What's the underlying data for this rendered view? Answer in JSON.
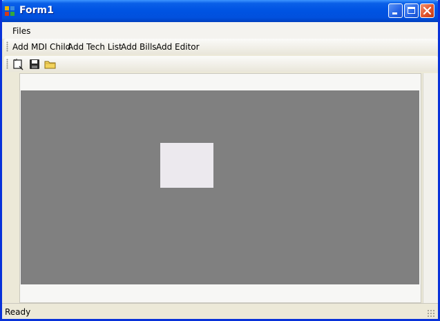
{
  "window": {
    "title": "Form1",
    "controls": {
      "minimize": "minimize",
      "maximize": "maximize",
      "close": "close"
    }
  },
  "menu": {
    "files_label": "Files"
  },
  "toolbar_text": {
    "items": [
      "Add MDI Child",
      "Add Tech List",
      "Add Bills",
      "Add Editor"
    ]
  },
  "toolbar_icons": {
    "icons": [
      "new-document-icon",
      "save-icon",
      "open-folder-icon"
    ]
  },
  "status": {
    "text": "Ready"
  },
  "colors": {
    "titlebar": "#0054e3",
    "mdi_background": "#808080",
    "window_face": "#ece9d8"
  }
}
